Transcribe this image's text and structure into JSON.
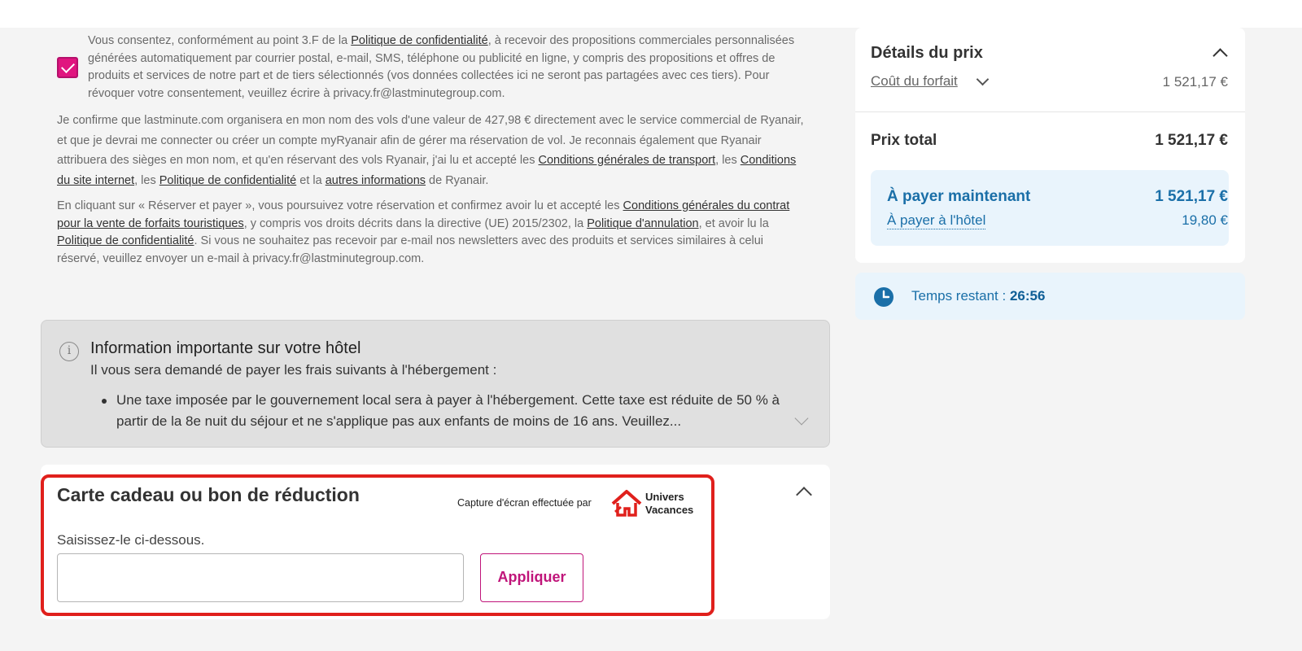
{
  "consent": {
    "checkbox_checked": true,
    "text_1": "Vous consentez, conformément au point 3.F de la ",
    "privacy_link_1": "Politique de confidentialité",
    "text_2": ", à recevoir des propositions commerciales personnalisées générées automatiquement par courrier postal, e-mail, SMS, téléphone ou publicité en ligne, y compris des propositions et offres de produits et services de notre part et de tiers sélectionnés (vos données collectées ici ne seront pas partagées avec ces tiers). Pour révoquer votre consentement, veuillez écrire à privacy.fr@lastminutegroup.com."
  },
  "ryanair": {
    "text_1": "Je confirme que lastminute.com organisera en mon nom des vols d'une valeur de 427,98 € directement avec le service commercial de Ryanair, et que je devrai me connecter ou créer un compte myRyanair afin de gérer ma réservation de vol. Je reconnais également que Ryanair attribuera des sièges en mon nom, et qu'en réservant des vols Ryanair, j'ai lu et accepté les ",
    "link_transport": "Conditions générales de transport",
    "sep_1": ", les ",
    "link_site": "Conditions du site internet",
    "sep_2": ", les ",
    "link_privacy": "Politique de confidentialité",
    "sep_3": " et la ",
    "link_other": "autres informations",
    "text_2": " de Ryanair."
  },
  "booking_terms": {
    "text_1": "En cliquant sur « Réserver et payer », vous poursuivez votre réservation et confirmez avoir lu et accepté les ",
    "link_conditions": "Conditions générales du contrat pour la vente de forfaits touristiques",
    "text_2": ", y compris vos droits décrits dans la directive (UE) 2015/2302, la ",
    "link_cancel": "Politique d'annulation",
    "text_3": ", et avoir lu la ",
    "link_privacy": "Politique de confidentialité",
    "text_4": ". Si vous ne souhaitez pas recevoir par e-mail nos newsletters avec des produits et services similaires à celui réservé, veuillez envoyer un e-mail à privacy.fr@lastminutegroup.com."
  },
  "hotel_info": {
    "icon": "info-icon",
    "title": "Information importante sur votre hôtel",
    "subtitle": "Il vous sera demandé de payer les frais suivants à l'hébergement :",
    "bullet": "Une taxe imposée par le gouvernement local sera à payer à l'hébergement. Cette taxe est réduite de 50 % à partir de la 8e nuit du séjour et ne s'applique pas aux enfants de moins de 16 ans. Veuillez..."
  },
  "gift_card": {
    "title": "Carte cadeau ou bon de réduction",
    "label": "Saisissez-le ci-dessous.",
    "input_value": "",
    "apply_label": "Appliquer",
    "credit_text": "Capture d'écran effectuée par",
    "brand_line_1": "Univers",
    "brand_line_2": "Vacances",
    "highlight_color": "#e0201c"
  },
  "price_details": {
    "title": "Détails du prix",
    "cost_label": "Coût du forfait",
    "cost_value": "1 521,17 €",
    "total_label": "Prix total",
    "total_value": "1 521,17 €",
    "pay_now_label": "À payer maintenant",
    "pay_now_value": "1 521,17 €",
    "pay_hotel_label": "À payer à l'hôtel",
    "pay_hotel_value": "19,80 €"
  },
  "timer": {
    "label": "Temps restant : ",
    "value": "26:56"
  },
  "colors": {
    "accent_pink": "#e0157f",
    "accent_blue": "#1a6fa8",
    "panel_bg": "#e9f4fc"
  }
}
